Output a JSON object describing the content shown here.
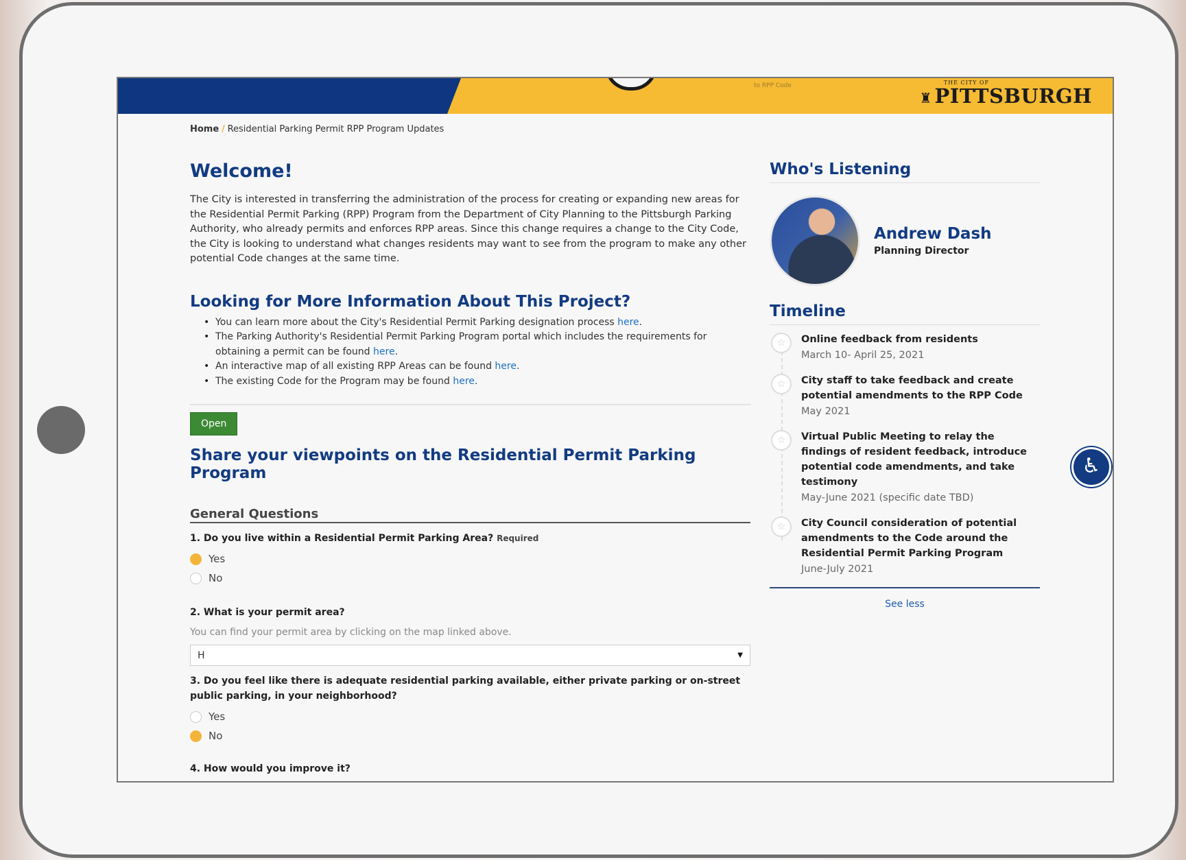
{
  "banner": {
    "tagline": "to RPP Code",
    "logo_small": "THE CITY OF",
    "logo_big": "PITTSBURGH"
  },
  "breadcrumb": {
    "home": "Home",
    "current": "Residential Parking Permit RPP Program Updates"
  },
  "welcome": {
    "title": "Welcome!",
    "body": "The City is interested in transferring the administration of the process for creating or expanding new areas for the Residential Permit Parking (RPP) Program from the Department of City Planning to the Pittsburgh Parking Authority, who already permits and enforces RPP areas. Since this change requires a change to the City Code, the City is looking to understand what changes residents may want to see from the program to make any other potential Code changes at the same time."
  },
  "more_info": {
    "title": "Looking for More Information About This Project?",
    "items": [
      {
        "text": "You can learn more about the City's Residential Permit Parking designation process ",
        "link": "here",
        "end": "."
      },
      {
        "text": "The Parking Authority's Residential Permit Parking Program portal which includes the requirements for obtaining a permit can be found ",
        "link": "here",
        "end": "."
      },
      {
        "text": "An interactive map of all existing RPP Areas can be found ",
        "link": "here",
        "end": "."
      },
      {
        "text": "The existing Code for the Program may be found ",
        "link": "here",
        "end": "."
      }
    ]
  },
  "survey": {
    "status": "Open",
    "title": "Share your viewpoints on the Residential Permit Parking Program",
    "section": "General Questions",
    "q1": {
      "label": "1. Do you live within a Residential Permit Parking Area?",
      "required": "Required",
      "options": [
        "Yes",
        "No"
      ],
      "selected": "Yes"
    },
    "q2": {
      "label": "2. What is your permit area?",
      "hint": "You can find your permit area by clicking on the map linked above.",
      "value": "H"
    },
    "q3": {
      "label": "3. Do you feel like there is adequate residential parking available, either private parking or on-street public parking, in your neighborhood?",
      "options": [
        "Yes",
        "No"
      ],
      "selected": "No"
    },
    "q4": {
      "label": "4. How would you improve it?"
    }
  },
  "sidebar": {
    "listening_title": "Who's Listening",
    "person": {
      "name": "Andrew Dash",
      "role": "Planning Director"
    },
    "timeline_title": "Timeline",
    "timeline": [
      {
        "title": "Online feedback from residents",
        "date": "March 10- April 25, 2021"
      },
      {
        "title": "City staff to take feedback and create potential amendments to the RPP Code",
        "date": "May 2021"
      },
      {
        "title": "Virtual Public Meeting to relay the findings of resident feedback, introduce potential code amendments, and take testimony",
        "date": "May-June 2021 (specific date TBD)"
      },
      {
        "title": "City Council consideration of potential amendments to the Code around the Residential Permit Parking Program",
        "date": "June-July 2021"
      }
    ],
    "see_less": "See less"
  },
  "icons": {
    "accessibility": "accessibility-icon",
    "timeline_star": "star-icon",
    "select_caret": "caret-down-icon"
  }
}
